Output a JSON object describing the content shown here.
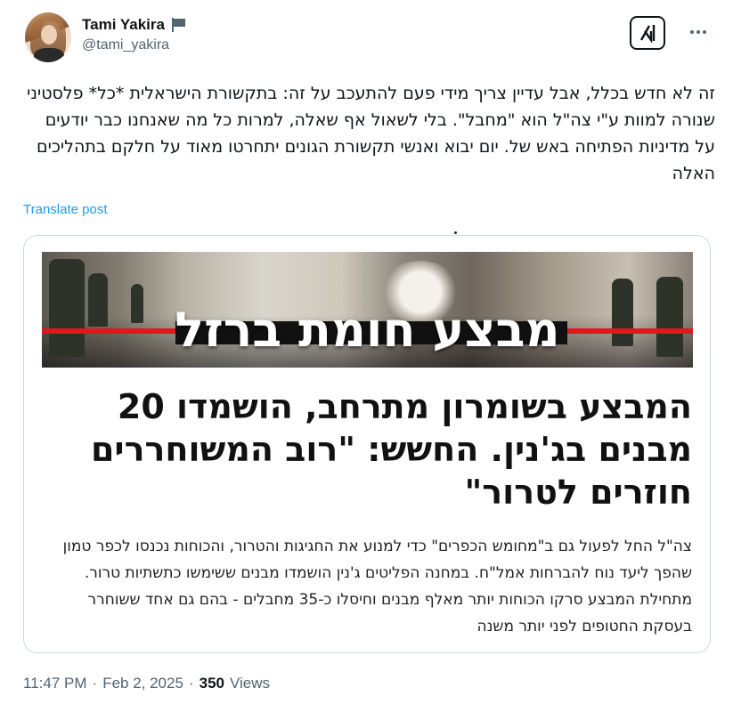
{
  "author": {
    "display_name": "Tami Yakira",
    "handle": "@tami_yakira",
    "badge_icon": "flag-icon"
  },
  "tweet": {
    "text": "זה לא חדש בכלל, אבל עדיין צריך מידי פעם להתעכב על זה: בתקשורת הישראלית *כל* פלסטיני שנורה למוות ע\"י צה\"ל הוא \"מחבל\". בלי לשאול אף שאלה, למרות כל מה שאנחנו כבר יודעים על מדיניות הפתיחה באש של. יום יבוא ואנשי תקשורת הגונים יתחרטו מאוד על חלקם בתהליכים האלה",
    "translate_label": "Translate post"
  },
  "card": {
    "banner_title": "מבצע חומת ברזל",
    "headline": "המבצע בשומרון מתרחב, הושמדו 20 מבנים בג'נין. החשש: \"רוב המשוחררים חוזרים לטרור\"",
    "body": "צה\"ל החל לפעול גם ב\"מחומש הכפרים\" כדי למנוע את החגיגות והטרור, והכוחות נכנסו לכפר טמון שהפך ליעד נוח להברחות אמל\"ח. במחנה הפליטים ג'נין הושמדו מבנים ששימשו כתשתיות טרור. מתחילת המבצע סרקו הכוחות יותר מאלף מבנים וחיסלו כ-35 מחבלים - בהם גם אחד ששוחרר בעסקת החטופים לפני יותר משנה"
  },
  "meta": {
    "time": "11:47 PM",
    "separator": "·",
    "date": "Feb 2, 2025",
    "views_count": "350",
    "views_label": "Views"
  },
  "icons": {
    "grok": "grok-icon",
    "more": "more-icon"
  },
  "colors": {
    "link": "#1d9bf0",
    "secondary_text": "#536471",
    "banner_red": "#e0171b"
  }
}
